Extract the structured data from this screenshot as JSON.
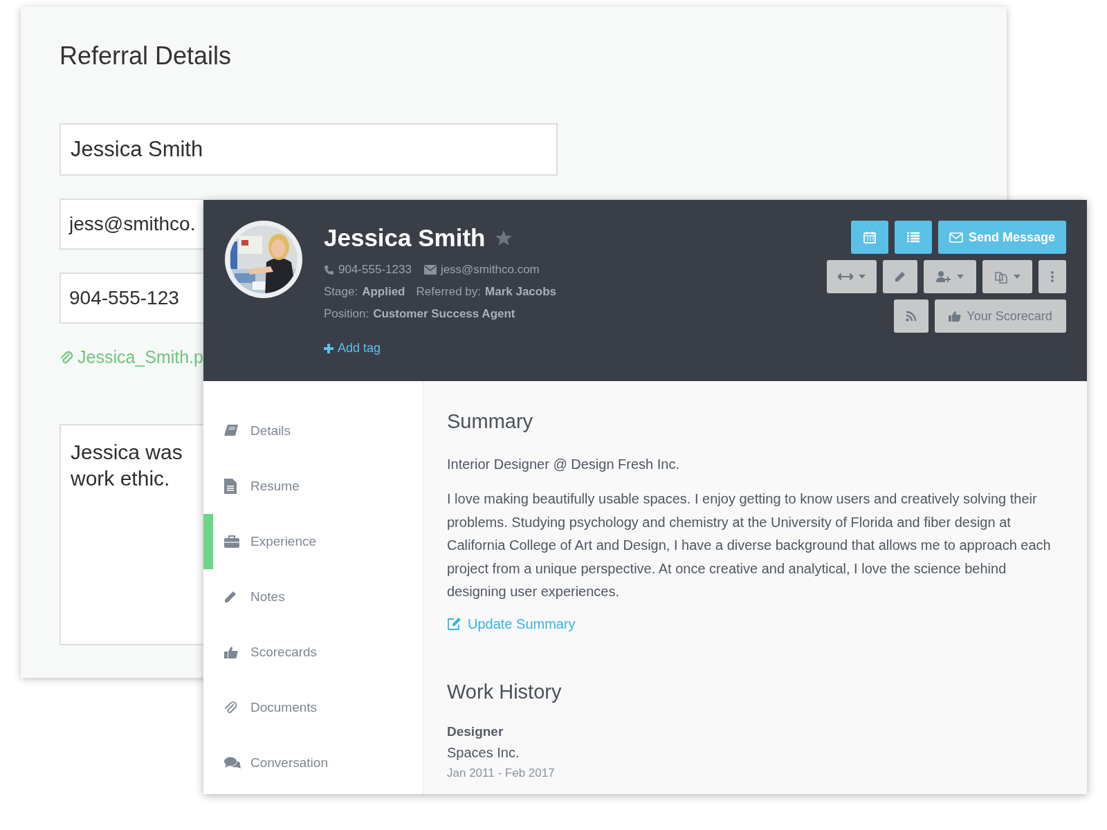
{
  "referral_form": {
    "title": "Referral Details",
    "name_field": {
      "value": "Jessica Smith"
    },
    "email_field": {
      "value": "jess@smithco."
    },
    "phone_field": {
      "value": "904-555-123"
    },
    "attachment": "Jessica_Smith.p",
    "note_field": {
      "lines": [
        "Jessica was",
        "work ethic."
      ]
    }
  },
  "profile": {
    "name": "Jessica Smith",
    "starred": false,
    "phone": "904-555-1233",
    "email": "jess@smithco.com",
    "stage_label": "Stage:",
    "stage": "Applied",
    "referred_label": "Referred by:",
    "referred_by": "Mark Jacobs",
    "position_label": "Position:",
    "position": "Customer Success Agent",
    "add_tag": "Add tag",
    "actions": [
      [
        {
          "kind": "calendar"
        },
        {
          "kind": "list"
        },
        {
          "kind": "envelope",
          "label": "Send Message"
        }
      ],
      [
        {
          "kind": "arrows",
          "dropdown": true
        },
        {
          "kind": "pencil",
          "dropdown": false
        },
        {
          "kind": "add-user",
          "dropdown": true
        },
        {
          "kind": "copy",
          "dropdown": true
        },
        {
          "kind": "dots",
          "dropdown": false
        }
      ],
      [
        {
          "kind": "rss"
        },
        {
          "kind": "thumb",
          "label": "Your Scorecard"
        }
      ]
    ]
  },
  "sidebar": {
    "items": [
      {
        "label": "Details",
        "kind": "book",
        "selected": false
      },
      {
        "label": "Resume",
        "kind": "file",
        "selected": false
      },
      {
        "label": "Experience",
        "kind": "briefcase",
        "selected": true
      },
      {
        "label": "Notes",
        "kind": "pencil",
        "selected": false
      },
      {
        "label": "Scorecards",
        "kind": "thumb",
        "selected": false
      },
      {
        "label": "Documents",
        "kind": "paperclip",
        "selected": false
      },
      {
        "label": "Conversation",
        "kind": "chat",
        "selected": false
      }
    ]
  },
  "summary": {
    "heading": "Summary",
    "headline": "Interior Designer @ Design Fresh Inc.",
    "body": "I love making beautifully usable spaces. I enjoy getting to know users and creatively solving their problems. Studying psychology and chemistry at the University of Florida and fiber design at California College of Art and Design, I have a diverse background that allows me to approach each project from a unique perspective. At once creative and analytical, I love the science behind designing user experiences.",
    "update_link": "Update Summary"
  },
  "work_history": {
    "heading": "Work History",
    "entries": [
      {
        "title": "Designer",
        "company": "Spaces Inc.",
        "dates": "Jan 2011 - Feb 2017"
      }
    ]
  }
}
